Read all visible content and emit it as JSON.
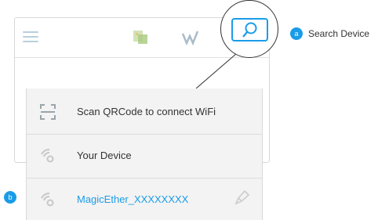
{
  "annotations": {
    "a": {
      "badge": "a",
      "label": "Search Device"
    },
    "b": {
      "badge": "b"
    }
  },
  "toolbar": {
    "icons": [
      "menu-icon",
      "app-status-icon",
      "wifi-signal-icon",
      "search-device-icon"
    ]
  },
  "dropdown": {
    "items": [
      {
        "icon": "qr-scan-icon",
        "label": "Scan QRCode to connect WiFi"
      },
      {
        "icon": "wifi-icon",
        "label": "Your Device"
      },
      {
        "icon": "wifi-icon",
        "label": "MagicEther_XXXXXXXX",
        "action_icon": "edit-icon"
      }
    ]
  },
  "colors": {
    "accent": "#1a9ce8",
    "panel": "#f3f3f3",
    "text": "#333333"
  }
}
